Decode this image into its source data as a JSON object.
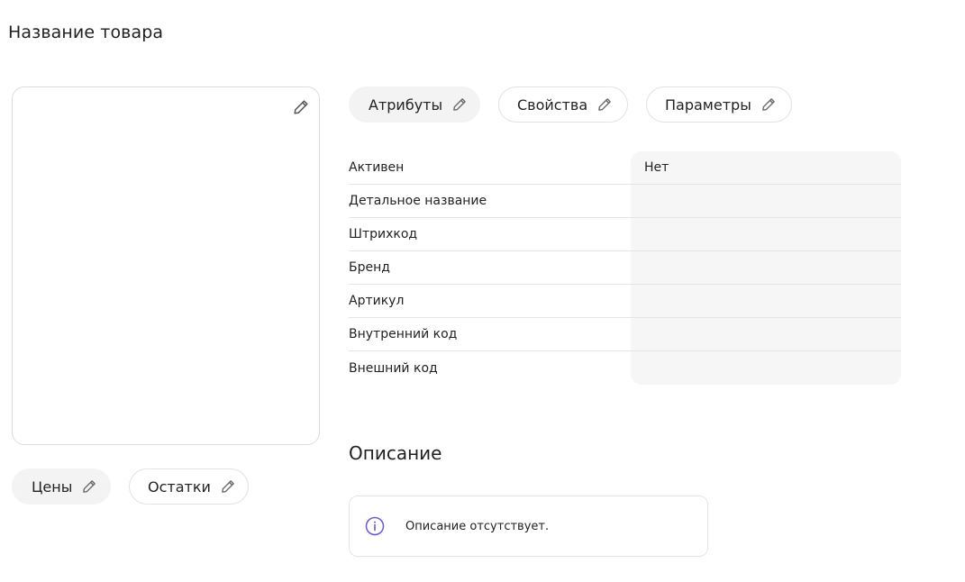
{
  "page": {
    "title": "Название товара"
  },
  "tabs": [
    {
      "label": "Атрибуты",
      "icon": "pencil-icon",
      "active": true
    },
    {
      "label": "Свойства",
      "icon": "pencil-icon",
      "active": false
    },
    {
      "label": "Параметры",
      "icon": "pencil-icon",
      "active": false
    }
  ],
  "bottom_tabs": [
    {
      "label": "Цены",
      "icon": "pencil-icon",
      "active": true
    },
    {
      "label": "Остатки",
      "icon": "pencil-icon",
      "active": false
    }
  ],
  "attributes": [
    {
      "label": "Активен",
      "value": "Нет"
    },
    {
      "label": "Детальное название",
      "value": ""
    },
    {
      "label": "Штрихкод",
      "value": ""
    },
    {
      "label": "Бренд",
      "value": ""
    },
    {
      "label": "Артикул",
      "value": ""
    },
    {
      "label": "Внутренний код",
      "value": ""
    },
    {
      "label": "Внешний код",
      "value": ""
    }
  ],
  "description": {
    "title": "Описание",
    "empty_text": "Описание отсутствует.",
    "icon": "info-icon"
  },
  "colors": {
    "accent": "#6a5acd",
    "border": "#e2e2e2",
    "pill_filled": "#f3f3f3",
    "value_bg": "#f6f6f6"
  }
}
